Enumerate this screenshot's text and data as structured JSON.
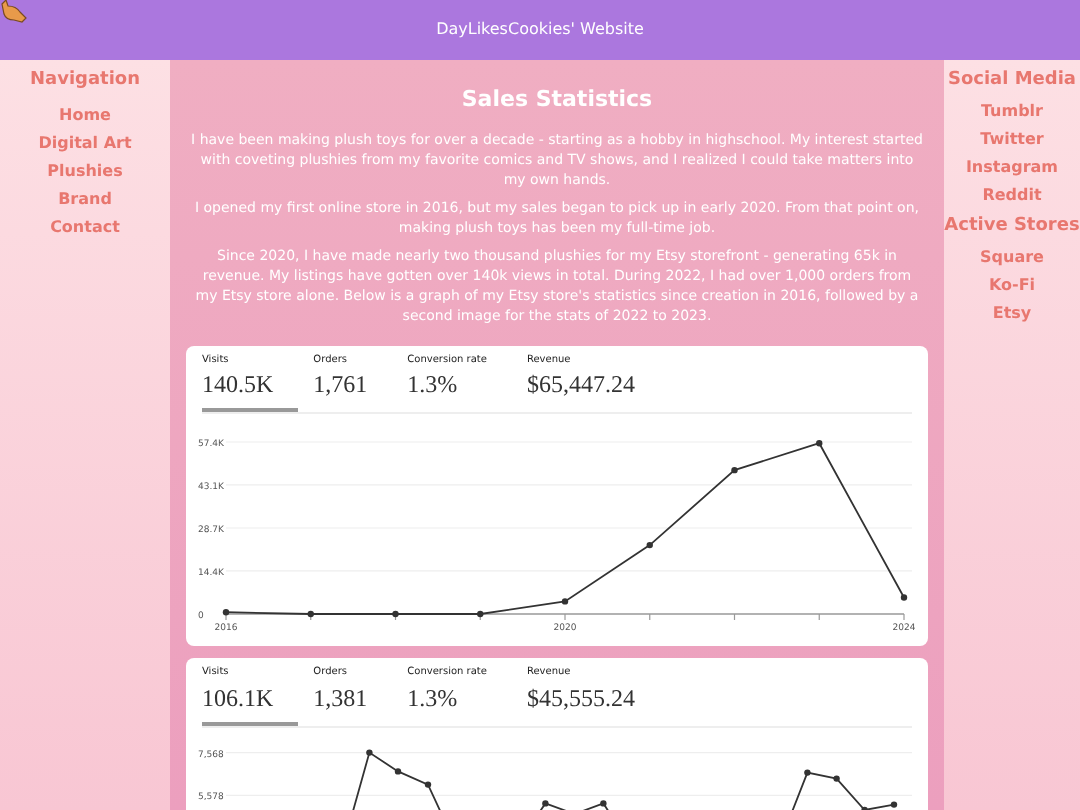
{
  "header": {
    "title": "DayLikesCookies' Website"
  },
  "left_sidebar": {
    "title": "Navigation",
    "items": [
      "Home",
      "Digital Art",
      "Plushies",
      "Brand",
      "Contact"
    ]
  },
  "main": {
    "title": "Sales Statistics",
    "paragraphs": [
      "I have been making plush toys for over a decade - starting as a hobby in highschool. My interest started with coveting plushies from my favorite comics and TV shows, and I realized I could take matters into my own hands.",
      "I opened my first online store in 2016, but my sales began to pick up in early 2020. From that point on, making plush toys has been my full-time job.",
      "Since 2020, I have made nearly two thousand plushies for my Etsy storefront - generating 65k in revenue. My listings have gotten over 140k views in total. During 2022, I had over 1,000 orders from my Etsy store alone. Below is a graph of my Etsy store's statistics since creation in 2016, followed by a second image for the stats of 2022 to 2023."
    ],
    "stat_cards": [
      {
        "metrics": [
          {
            "label": "Visits",
            "value": "140.5K",
            "selected": true
          },
          {
            "label": "Orders",
            "value": "1,761",
            "selected": false
          },
          {
            "label": "Conversion rate",
            "value": "1.3%",
            "selected": false
          },
          {
            "label": "Revenue",
            "value": "$65,447.24",
            "selected": false
          }
        ],
        "chart_data": {
          "type": "line",
          "grid": true,
          "x": [
            2016,
            2017,
            2018,
            2019,
            2020,
            2021,
            2022,
            2023,
            2024
          ],
          "xlim": [
            2016,
            2024
          ],
          "xticks": [
            2016,
            2020,
            2024
          ],
          "ylim": [
            0,
            57400
          ],
          "yticks": [
            {
              "value": 0,
              "label": "0"
            },
            {
              "value": 14400,
              "label": "14.4K"
            },
            {
              "value": 28700,
              "label": "28.7K"
            },
            {
              "value": 43100,
              "label": "43.1K"
            },
            {
              "value": 57400,
              "label": "57.4K"
            }
          ],
          "series": [
            {
              "color": "#333333",
              "marker": "circle",
              "values": [
                600,
                0,
                0,
                0,
                4200,
                23000,
                48000,
                57000,
                5500
              ]
            }
          ]
        }
      },
      {
        "metrics": [
          {
            "label": "Visits",
            "value": "106.1K",
            "selected": true
          },
          {
            "label": "Orders",
            "value": "1,381",
            "selected": false
          },
          {
            "label": "Conversion rate",
            "value": "1.3%",
            "selected": false
          },
          {
            "label": "Revenue",
            "value": "$45,555.24",
            "selected": false
          }
        ],
        "axis_labels": [
          "7,568",
          "5,578"
        ]
      }
    ]
  },
  "right_sidebar": {
    "sections": [
      {
        "title": "Social Media",
        "items": [
          "Tumblr",
          "Twitter",
          "Instagram",
          "Reddit"
        ]
      },
      {
        "title": "Active Stores",
        "items": [
          "Square",
          "Ko-Fi",
          "Etsy"
        ]
      }
    ]
  }
}
